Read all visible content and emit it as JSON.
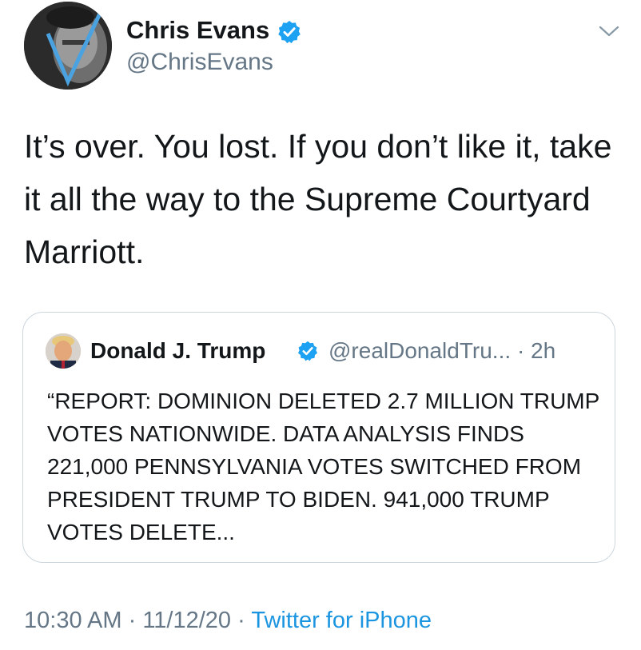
{
  "author": {
    "name": "Chris Evans",
    "handle": "@ChrisEvans",
    "verified_icon": "verified-badge-icon",
    "avatar_icon": "profile-photo"
  },
  "header": {
    "menu_icon": "chevron-down-icon"
  },
  "tweet": {
    "text": "It’s over. You lost. If you don’t like it, take it all the way to the Supreme Courtyard Marriott."
  },
  "quoted_tweet": {
    "author_name": "Donald J. Trump",
    "handle": "@realDonaldTru...",
    "separator": "·",
    "time_ago": "2h",
    "text": "“REPORT: DOMINION DELETED 2.7 MILLION TRUMP VOTES NATIONWIDE. DATA ANALYSIS FINDS 221,000 PENNSYLVANIA VOTES SWITCHED FROM PRESIDENT TRUMP TO BIDEN. 941,000 TRUMP VOTES DELETE..."
  },
  "footer": {
    "time": "10:30 AM",
    "separator": "·",
    "date": "11/12/20",
    "source": "Twitter for iPhone"
  },
  "colors": {
    "text_primary": "#14171a",
    "text_secondary": "#657786",
    "link": "#1b95e0",
    "verified": "#1da1f2",
    "border": "#ccd6dd"
  }
}
